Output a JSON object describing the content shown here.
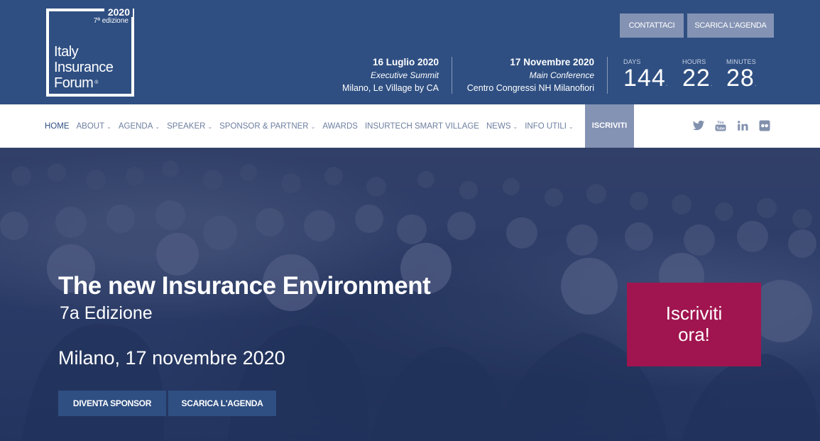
{
  "logo": {
    "year": "2020",
    "edition": "7ª edizione",
    "line1": "Italy",
    "line2": "Insurance",
    "line3": "Forum",
    "reg": "®"
  },
  "header": {
    "contact_label": "CONTATTACI",
    "agenda_label": "SCARICA L'AGENDA"
  },
  "events": [
    {
      "date": "16 Luglio 2020",
      "name": "Executive Summit",
      "place": "Milano, Le Village by CA"
    },
    {
      "date": "17 Novembre 2020",
      "name": "Main Conference",
      "place": "Centro Congressi NH Milanofiori"
    }
  ],
  "countdown": {
    "days_label": "DAYS",
    "days": "144",
    "hours_label": "HOURS",
    "hours": "22",
    "minutes_label": "MINUTES",
    "minutes": "28"
  },
  "nav": {
    "items": [
      {
        "label": "HOME",
        "dropdown": false
      },
      {
        "label": "ABOUT",
        "dropdown": true
      },
      {
        "label": "AGENDA",
        "dropdown": true
      },
      {
        "label": "SPEAKER",
        "dropdown": true
      },
      {
        "label": "SPONSOR & PARTNER",
        "dropdown": true
      },
      {
        "label": "AWARDS",
        "dropdown": false
      },
      {
        "label": "INSURTECH SMART VILLAGE",
        "dropdown": false
      },
      {
        "label": "NEWS",
        "dropdown": true
      },
      {
        "label": "INFO UTILI",
        "dropdown": true
      }
    ],
    "cta_label": "ISCRIVITI",
    "chevron": "⌄"
  },
  "socials": [
    {
      "icon": "twitter-icon",
      "glyph": "🐦"
    },
    {
      "icon": "youtube-icon",
      "glyph": "▶"
    },
    {
      "icon": "linkedin-icon",
      "glyph": "in"
    },
    {
      "icon": "flickr-icon",
      "glyph": "●●"
    }
  ],
  "hero": {
    "title": "The new Insurance Environment",
    "edition": "7a Edizione",
    "city_date": "Milano, 17 novembre 2020",
    "sponsor_label": "DIVENTA SPONSOR",
    "agenda_label": "SCARICA L'AGENDA",
    "cta_line1": "Iscriviti",
    "cta_line2": "ora!"
  },
  "colors": {
    "header_bg": "#2f4f82",
    "accent_button": "#8493b4",
    "cta_bg": "#a0154f"
  }
}
